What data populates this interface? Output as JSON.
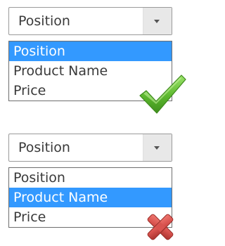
{
  "examples": [
    {
      "select": {
        "value": "Position"
      },
      "options": [
        "Position",
        "Product Name",
        "Price"
      ],
      "highlighted_option": "Position",
      "status_icon": "checkmark-icon",
      "status_color": "#5cb82e"
    },
    {
      "select": {
        "value": "Position"
      },
      "options": [
        "Position",
        "Product Name",
        "Price"
      ],
      "highlighted_option": "Product Name",
      "status_icon": "cross-icon",
      "status_color": "#d9534f"
    }
  ],
  "colors": {
    "highlight": "#3399ff",
    "highlight_text": "#ffffff",
    "text": "#3a3a3a"
  }
}
